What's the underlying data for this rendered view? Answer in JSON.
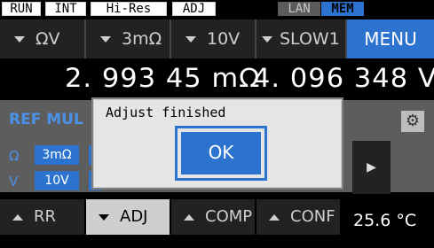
{
  "status": {
    "run": "RUN",
    "int": "INT",
    "hires": "Hi-Res",
    "adj": "ADJ",
    "lan": "LAN",
    "mem": "MEM"
  },
  "range_bar": {
    "function": "ΩV",
    "resistance_range": "3mΩ",
    "voltage_range": "10V",
    "speed": "SLOW1",
    "menu": "MENU"
  },
  "readings": {
    "resistance": "2. 993 45 mΩ",
    "voltage": "4. 096 348 V"
  },
  "panel": {
    "ref_label": "REF MUL",
    "row1_label": "Ω",
    "row1_value": "3mΩ",
    "row2_label": "V",
    "row2_value": "10V",
    "gear_icon": "gear-icon",
    "next_icon": "chevron-right-icon"
  },
  "dialog": {
    "message": "Adjust finished",
    "ok_label": "OK"
  },
  "bottom_bar": {
    "rr": "RR",
    "adj": "ADJ",
    "comp": "COMP",
    "conf": "CONF",
    "temperature": "25.6 °C"
  },
  "colors": {
    "accent_blue": "#2c73cf",
    "panel_gray": "#5d5d5d",
    "dialog_bg": "#e5e5e5"
  }
}
